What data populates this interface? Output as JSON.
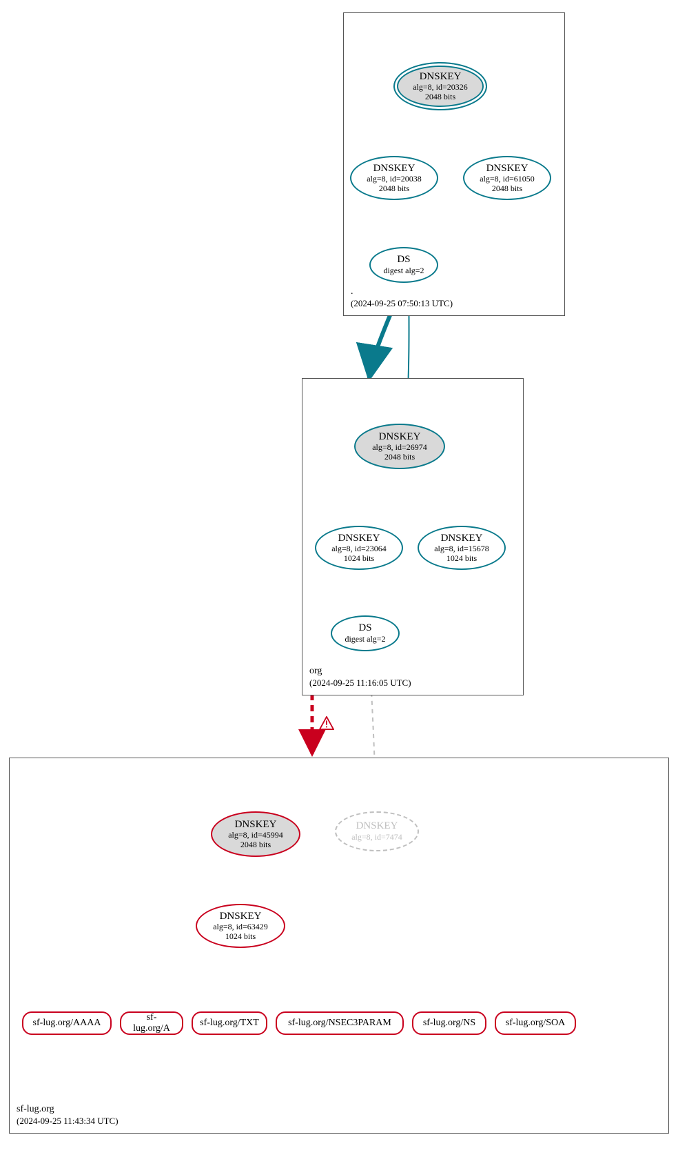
{
  "zones": {
    "root": {
      "name": ".",
      "timestamp": "(2024-09-25 07:50:13 UTC)"
    },
    "org": {
      "name": "org",
      "timestamp": "(2024-09-25 11:16:05 UTC)"
    },
    "leaf": {
      "name": "sf-lug.org",
      "timestamp": "(2024-09-25 11:43:34 UTC)"
    }
  },
  "nodes": {
    "root_ksk": {
      "title": "DNSKEY",
      "alg": "alg=8, id=20326",
      "bits": "2048 bits"
    },
    "root_zsk1": {
      "title": "DNSKEY",
      "alg": "alg=8, id=20038",
      "bits": "2048 bits"
    },
    "root_zsk2": {
      "title": "DNSKEY",
      "alg": "alg=8, id=61050",
      "bits": "2048 bits"
    },
    "root_ds": {
      "title": "DS",
      "alg": "digest alg=2"
    },
    "org_ksk": {
      "title": "DNSKEY",
      "alg": "alg=8, id=26974",
      "bits": "2048 bits"
    },
    "org_zsk1": {
      "title": "DNSKEY",
      "alg": "alg=8, id=23064",
      "bits": "1024 bits"
    },
    "org_zsk2": {
      "title": "DNSKEY",
      "alg": "alg=8, id=15678",
      "bits": "1024 bits"
    },
    "org_ds": {
      "title": "DS",
      "alg": "digest alg=2"
    },
    "leaf_ksk": {
      "title": "DNSKEY",
      "alg": "alg=8, id=45994",
      "bits": "2048 bits"
    },
    "leaf_faded": {
      "title": "DNSKEY",
      "alg": "alg=8, id=7474"
    },
    "leaf_zsk": {
      "title": "DNSKEY",
      "alg": "alg=8, id=63429",
      "bits": "1024 bits"
    }
  },
  "rrsets": {
    "aaaa": "sf-lug.org/AAAA",
    "a": "sf-lug.org/A",
    "txt": "sf-lug.org/TXT",
    "nsec3": "sf-lug.org/NSEC3PARAM",
    "ns": "sf-lug.org/NS",
    "soa": "sf-lug.org/SOA"
  },
  "colors": {
    "secure": "#0a7a8c",
    "insecure": "#c9001e",
    "faded": "#bfbfbf"
  }
}
